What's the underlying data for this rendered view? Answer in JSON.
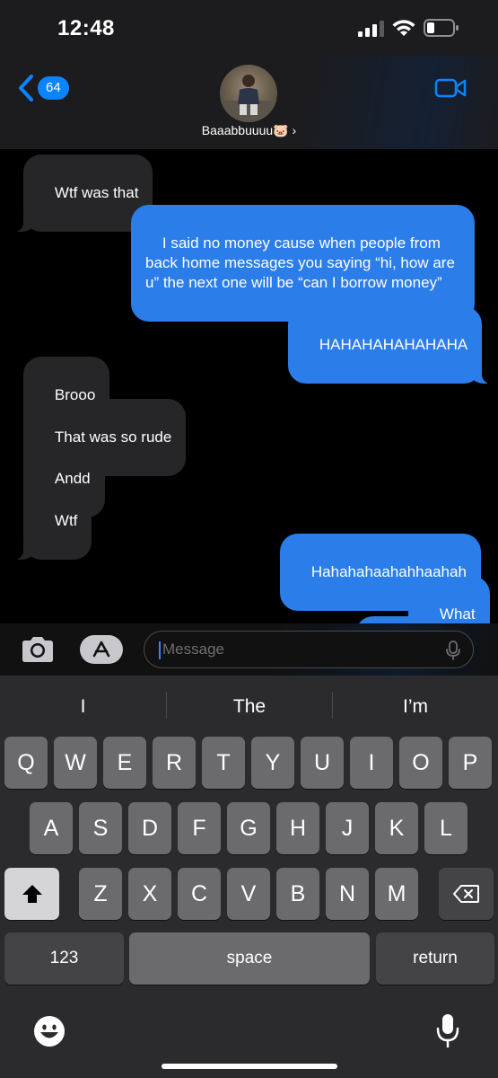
{
  "status_bar": {
    "time": "12:48"
  },
  "header": {
    "back_count": "64",
    "contact_name": "Baaabbuuuu🐷 ›"
  },
  "messages": [
    {
      "from": "them",
      "text": "Wtf was that"
    },
    {
      "from": "me",
      "text": "I said no money cause when people from back home messages you saying “hi, how are u” the next one will be “can I borrow money”"
    },
    {
      "from": "me",
      "text": "HAHAHAHAHAHAHA"
    },
    {
      "from": "them",
      "text": "Brooo"
    },
    {
      "from": "them",
      "text": "That was so rude"
    },
    {
      "from": "them",
      "text": "Andd"
    },
    {
      "from": "them",
      "text": "Wtf"
    },
    {
      "from": "me",
      "text": "Hahahahaahahhaahah"
    },
    {
      "from": "me",
      "text": "What"
    }
  ],
  "input": {
    "placeholder": "Message"
  },
  "keyboard": {
    "suggestions": [
      "I",
      "The",
      "I’m"
    ],
    "row1": [
      "Q",
      "W",
      "E",
      "R",
      "T",
      "Y",
      "U",
      "I",
      "O",
      "P"
    ],
    "row2": [
      "A",
      "S",
      "D",
      "F",
      "G",
      "H",
      "J",
      "K",
      "L"
    ],
    "row3": [
      "Z",
      "X",
      "C",
      "V",
      "B",
      "N",
      "M"
    ],
    "numbers_label": "123",
    "space_label": "space",
    "return_label": "return"
  },
  "colors": {
    "outgoing_bubble": "#2b7de9",
    "incoming_bubble": "#262628",
    "accent": "#0a84ff"
  }
}
